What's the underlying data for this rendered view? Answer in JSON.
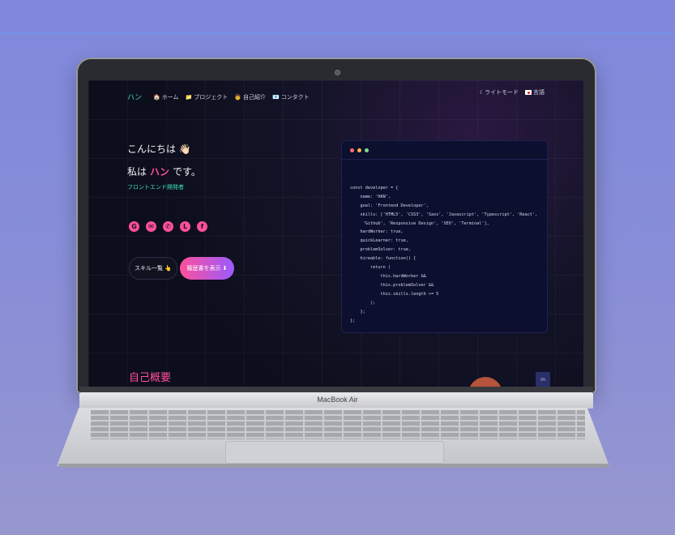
{
  "device": {
    "model_label": "MacBook Air"
  },
  "nav": {
    "logo": "ハン",
    "items": [
      {
        "icon": "house-icon",
        "glyph": "🏠",
        "label": "ホーム"
      },
      {
        "icon": "folder-icon",
        "glyph": "📁",
        "label": "プロジェクト"
      },
      {
        "icon": "person-icon",
        "glyph": "👨",
        "label": "自己紹介"
      },
      {
        "icon": "envelope-icon",
        "glyph": "📧",
        "label": "コンタクト"
      }
    ],
    "theme_toggle": "ライトモード",
    "language": "言語"
  },
  "hero": {
    "greeting": "こんにちは 👋🏻",
    "intro_prefix": "私は",
    "name": "ハン",
    "intro_suffix": "です。",
    "role": "フロントエンド開発者"
  },
  "socials": [
    {
      "icon": "github-icon",
      "glyph": "G"
    },
    {
      "icon": "mail-icon",
      "glyph": "✉"
    },
    {
      "icon": "phone-icon",
      "glyph": "✆"
    },
    {
      "icon": "line-icon",
      "glyph": "L"
    },
    {
      "icon": "facebook-icon",
      "glyph": "f"
    }
  ],
  "buttons": {
    "skills": "スキル一覧 👆",
    "resume": "履歴書を表示 ⬇"
  },
  "code": {
    "window_dots": [
      "#ff6b6b",
      "#ffb347",
      "#7ee08a"
    ],
    "lines": [
      "const developer = {",
      "    name: 'HAN',",
      "    goal: 'Frontend Developer',",
      "    skills: ['HTML5', 'CSS3', 'Sass', 'Javascript', 'Typescript', 'React',",
      "     'Github', 'Responsive Design', 'SEO', 'Terminal'],",
      "    hardWorker: true,",
      "    quickLearner: true,",
      "    problemSolver: true,",
      "    hireable: function() {",
      "        return (",
      "            this.hardWorker &&",
      "            this.problemSolver &&",
      "            this.skills.length >= 5",
      "        );",
      "    };",
      "};"
    ]
  },
  "about": {
    "heading": "自己概要"
  },
  "misc": {
    "badge": "m"
  }
}
